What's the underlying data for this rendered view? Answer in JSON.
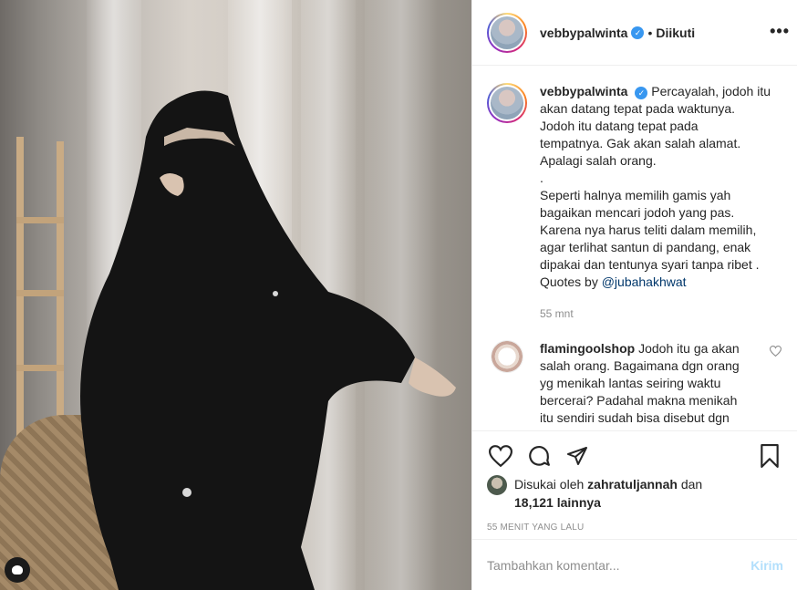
{
  "post": {
    "username": "vebbypalwinta",
    "follow_separator": "•",
    "follow_status": "Diikuti",
    "more_icon": "more-options-icon",
    "more_glyph": "•••"
  },
  "caption": {
    "username": "vebbypalwinta",
    "lines": [
      "Percayalah, jodoh itu",
      "akan datang tepat pada waktunya.",
      "Jodoh itu datang tepat pada",
      "tempatnya. Gak akan salah alamat.",
      "Apalagi salah orang.",
      ".",
      "Seperti halnya memilih gamis yah",
      "bagaikan mencari jodoh yang pas.",
      "Karena nya harus teliti dalam memilih,",
      "agar terlihat santun di pandang, enak",
      "dipakai dan tentunya syari tanpa ribet .",
      "Quotes by"
    ],
    "mention": "@jubahakhwat",
    "time": "55 mnt"
  },
  "comment": {
    "username": "flamingoolshop",
    "text_lines": [
      "Jodoh itu ga akan",
      "salah orang. Bagaimana dgn orang",
      "yg menikah lantas seiring waktu",
      "bercerai? Padahal makna menikah",
      "itu sendiri sudah bisa disebut dgn"
    ]
  },
  "likes": {
    "prefix": "Disukai oleh",
    "user": "zahratuljannah",
    "and": "dan",
    "count": "18,121 lainnya"
  },
  "post_time": "55 MENIT YANG LALU",
  "add_comment": {
    "placeholder": "Tambahkan komentar...",
    "post_label": "Kirim"
  },
  "colors": {
    "verified": "#3897f0",
    "mention": "#00376b",
    "post_button_disabled": "#b2dffc"
  }
}
